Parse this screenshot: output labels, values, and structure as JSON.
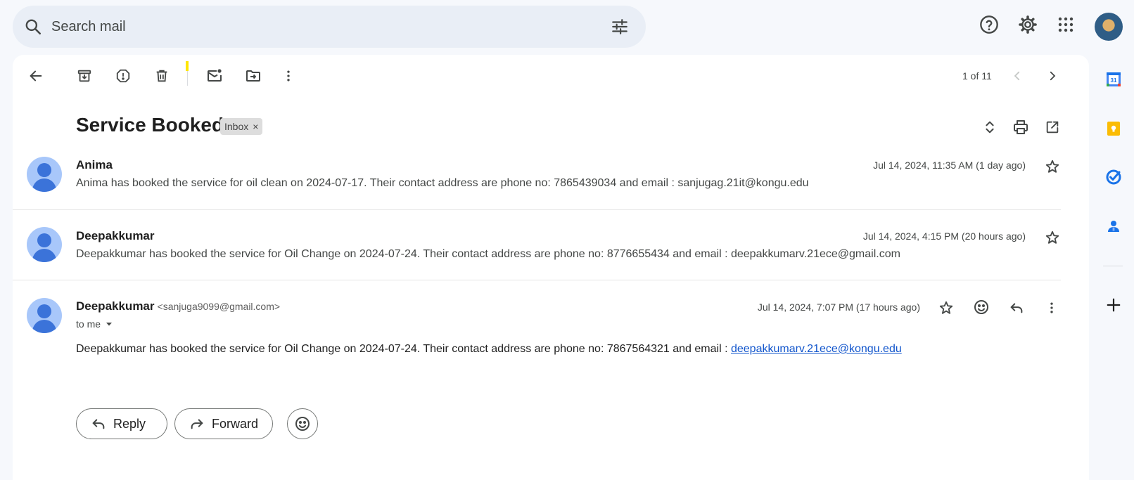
{
  "search": {
    "placeholder": "Search mail"
  },
  "toolbar": {
    "pager": "1 of 11"
  },
  "thread": {
    "subject": "Service Booked",
    "label": "Inbox",
    "label_close": "×"
  },
  "messages": [
    {
      "sender": "Anima",
      "snippet": "Anima has booked the service for oil clean on 2024-07-17. Their contact address are phone no: 7865439034 and email : sanjugag.21it@kongu.edu",
      "date": "Jul 14, 2024, 11:35 AM (1 day ago)"
    },
    {
      "sender": "Deepakkumar",
      "snippet": "Deepakkumar has booked the service for Oil Change on 2024-07-24. Their contact address are phone no: 8776655434 and email : deepakkumarv.21ece@gmail.com",
      "date": "Jul 14, 2024, 4:15 PM (20 hours ago)"
    },
    {
      "sender": "Deepakkumar",
      "sender_email": "<sanjuga9099@gmail.com>",
      "recipient": "to me",
      "date": "Jul 14, 2024, 7:07 PM (17 hours ago)",
      "body_text": "Deepakkumar has booked the service for Oil Change on 2024-07-24. Their contact address are phone no: 7867564321 and email : ",
      "body_link": "deepakkumarv.21ece@kongu.edu"
    }
  ],
  "actions": {
    "reply": "Reply",
    "forward": "Forward"
  },
  "side_panel": {
    "calendar_day": "31"
  }
}
